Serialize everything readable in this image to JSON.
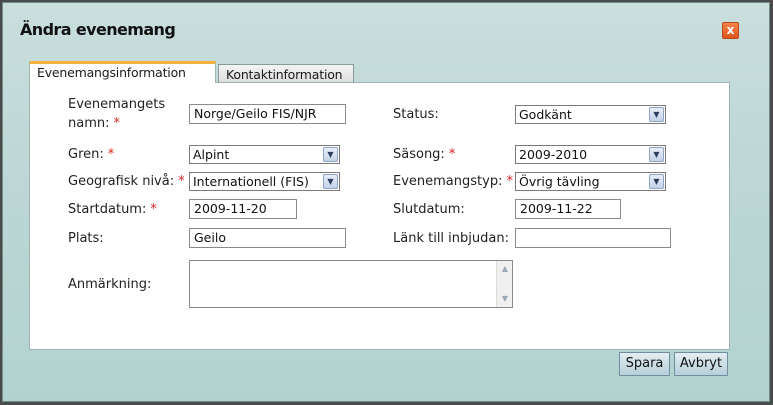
{
  "dialog": {
    "title": "Ändra evenemang",
    "close_label": "x"
  },
  "tabs": [
    {
      "label": "Evenemangsinformation",
      "active": true
    },
    {
      "label": "Kontaktinformation",
      "active": false
    }
  ],
  "form": {
    "name": {
      "label_line1": "Evenemangets",
      "label_line2": "namn:",
      "required": "*",
      "value": "Norge/Geilo FIS/NJR"
    },
    "status": {
      "label": "Status:",
      "value": "Godkänt"
    },
    "gren": {
      "label": "Gren:",
      "required": "*",
      "value": "Alpint"
    },
    "sasong": {
      "label": "Säsong:",
      "required": "*",
      "value": "2009-2010"
    },
    "geo": {
      "label": "Geografisk nivå:",
      "required": "*",
      "value": "Internationell (FIS)"
    },
    "typ": {
      "label": "Evenemangstyp:",
      "required": "*",
      "value": "Övrig tävling"
    },
    "startdatum": {
      "label": "Startdatum:",
      "required": "*",
      "value": "2009-11-20"
    },
    "slutdatum": {
      "label": "Slutdatum:",
      "value": "2009-11-22"
    },
    "plats": {
      "label": "Plats:",
      "value": "Geilo"
    },
    "lank": {
      "label": "Länk till inbjudan:",
      "value": ""
    },
    "anmarkning": {
      "label": "Anmärkning:",
      "value": ""
    }
  },
  "buttons": {
    "save_label": "Spara",
    "cancel_label": "Avbryt"
  },
  "colors": {
    "dialog_bg": "#bcd7d5",
    "active_tab_accent": "#f2b33d",
    "required": "#dd2222",
    "close_button": "#e0541a"
  }
}
